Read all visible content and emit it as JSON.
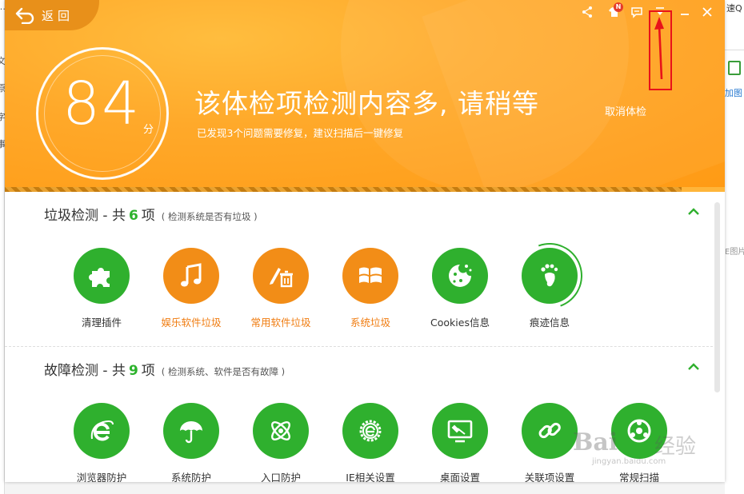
{
  "background": {
    "right_top_text": "速Q",
    "add_label": "加图",
    "mid_text": "E图片",
    "left_fragments": [
      "…",
      "文",
      "原",
      "字",
      "事"
    ]
  },
  "header": {
    "back_label": "返回",
    "score": "84",
    "score_unit": "分",
    "status_title": "该体检项检测内容多, 请稍等",
    "status_sub": "已发现3个问题需要修复，建议扫描后一键修复",
    "cancel_label": "取消体检",
    "progress_fraction": 0.94,
    "badge": "N"
  },
  "sections": [
    {
      "title": "垃圾检测 - 共",
      "count": "6",
      "unit": "项",
      "note": "( 检测系统是否有垃圾 )",
      "items": [
        {
          "label": "清理插件",
          "icon": "puzzle-icon",
          "color": "green"
        },
        {
          "label": "娱乐软件垃圾",
          "icon": "music-icon",
          "color": "orange"
        },
        {
          "label": "常用软件垃圾",
          "icon": "pen-trash-icon",
          "color": "orange"
        },
        {
          "label": "系统垃圾",
          "icon": "windows-icon",
          "color": "orange"
        },
        {
          "label": "Cookies信息",
          "icon": "cookie-icon",
          "color": "green"
        },
        {
          "label": "痕迹信息",
          "icon": "footprint-icon",
          "color": "green"
        }
      ]
    },
    {
      "title": "故障检测 - 共",
      "count": "9",
      "unit": "项",
      "note": "( 检测系统、软件是否有故障 )",
      "items": [
        {
          "label": "浏览器防护",
          "icon": "ie-icon",
          "color": "green"
        },
        {
          "label": "系统防护",
          "icon": "umbrella-icon",
          "color": "green"
        },
        {
          "label": "入口防护",
          "icon": "atom-icon",
          "color": "green"
        },
        {
          "label": "IE相关设置",
          "icon": "ie-gear-icon",
          "color": "green"
        },
        {
          "label": "桌面设置",
          "icon": "desktop-icon",
          "color": "green"
        },
        {
          "label": "关联项设置",
          "icon": "link-icon",
          "color": "green"
        },
        {
          "label": "常规扫描",
          "icon": "scan-icon",
          "color": "green"
        }
      ]
    }
  ],
  "watermark": {
    "brand": "Bai",
    "brand_tail": "经验",
    "url": "jingyan.baidu.com"
  },
  "colors": {
    "orange": "#ffa92a",
    "green": "#2fb02e",
    "annotation": "#e8121a"
  }
}
